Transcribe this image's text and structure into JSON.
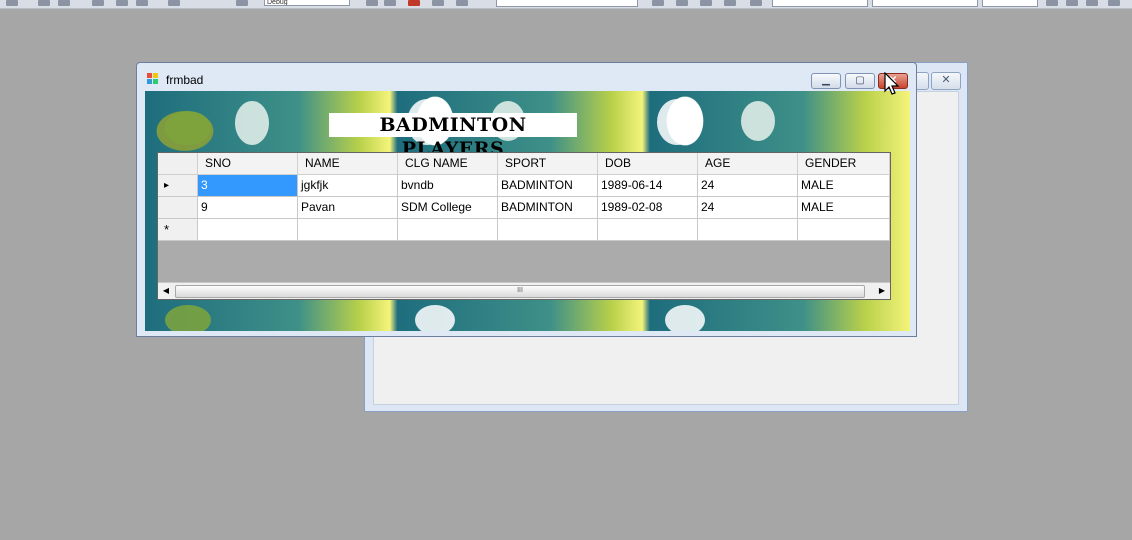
{
  "toolbar": {
    "combo_text": "Debug"
  },
  "window": {
    "title": "frmbad"
  },
  "form": {
    "heading": "BADMINTON PLAYERS"
  },
  "grid": {
    "columns": [
      "SNO",
      "NAME",
      "CLG NAME",
      "SPORT",
      "DOB",
      "AGE",
      "GENDER"
    ],
    "rows": [
      [
        "3",
        "jgkfjk",
        "bvndb",
        "BADMINTON",
        "1989-06-14",
        "24",
        "MALE"
      ],
      [
        "9",
        "Pavan",
        "SDM College",
        "BADMINTON",
        "1989-02-08",
        "24",
        "MALE"
      ]
    ],
    "new_row_glyph": "*",
    "current_row_glyph": "▸",
    "scroll_thumb_grip": "III"
  },
  "colors": {
    "desktop": "#a6a6a6",
    "selection": "#3399ff",
    "close_button": "#c8432c"
  },
  "icons": [
    "app-icon",
    "minimize-icon",
    "maximize-icon",
    "close-icon",
    "scroll-left-icon",
    "scroll-right-icon",
    "cursor-icon"
  ]
}
